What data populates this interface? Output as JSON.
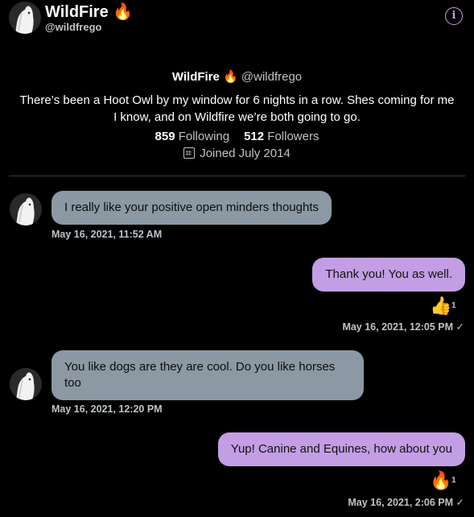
{
  "header": {
    "name": "WildFire 🔥",
    "handle": "@wildfrego",
    "info_icon": "i"
  },
  "profile": {
    "name": "WildFire 🔥",
    "handle": "@wildfrego",
    "bio": "There’s been a Hoot Owl by my window for 6 nights in a row. Shes coming for me I know, and on Wildfire we’re both going to go.",
    "following_count": "859",
    "following_label": "Following",
    "followers_count": "512",
    "followers_label": "Followers",
    "joined": "Joined July 2014"
  },
  "messages": [
    {
      "direction": "in",
      "text": "I really like your positive open minders thoughts",
      "time": "May 16, 2021, 11:52 AM"
    },
    {
      "direction": "out",
      "text": "Thank you! You as well.",
      "reaction": "👍",
      "reaction_count": "1",
      "time": "May 16, 2021, 12:05 PM",
      "check": "✓"
    },
    {
      "direction": "in",
      "text": "You like dogs are they are cool. Do you like horses too",
      "time": "May 16, 2021, 12:20 PM"
    },
    {
      "direction": "out",
      "text": "Yup! Canine and Equines, how about you",
      "reaction": "🔥",
      "reaction_count": "1",
      "time": "May 16, 2021, 2:06 PM",
      "check": "✓"
    }
  ],
  "colors": {
    "background": "#000000",
    "incoming_bubble": "#8c98a3",
    "outgoing_bubble": "#c39ee4",
    "accent": "#c8a0f0"
  }
}
